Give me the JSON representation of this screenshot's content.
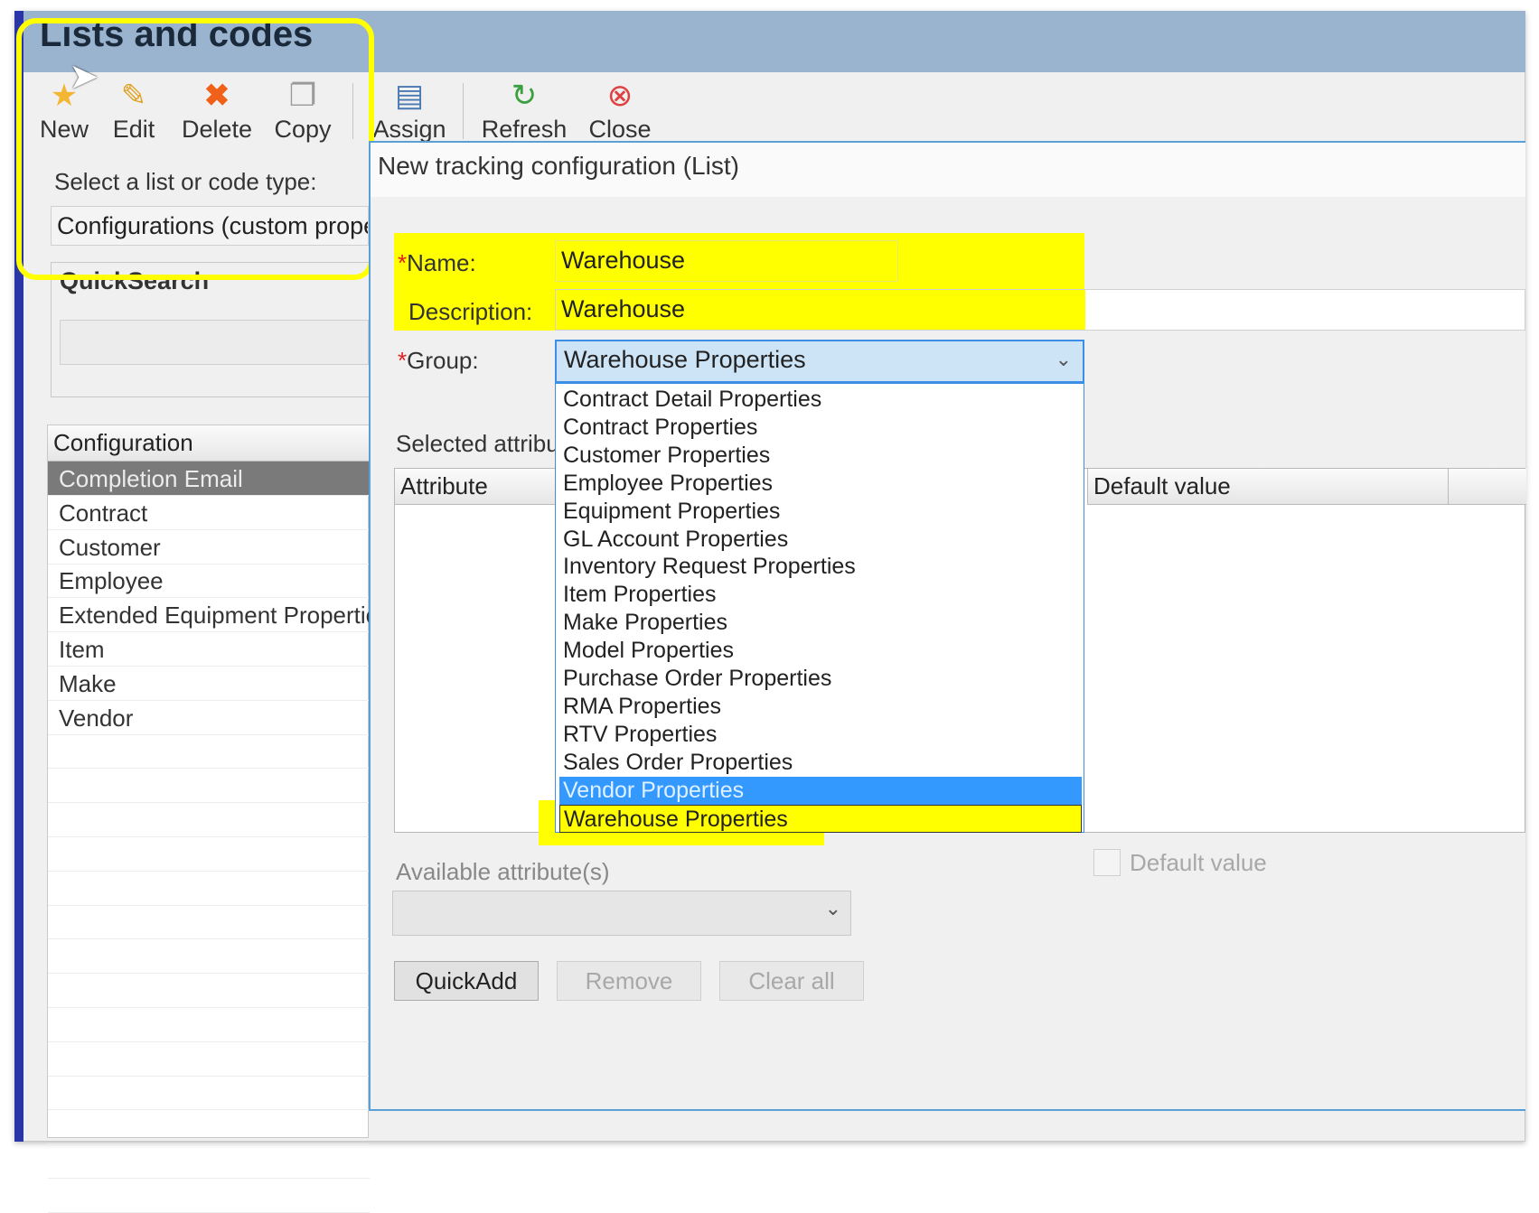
{
  "app": {
    "title": "Lists and codes"
  },
  "toolbar": {
    "new": "New",
    "edit": "Edit",
    "delete": "Delete",
    "copy": "Copy",
    "assign": "Assign",
    "refresh": "Refresh",
    "close": "Close"
  },
  "left": {
    "select_label": "Select a list or code type:",
    "select_value": "Configurations (custom proper",
    "quicksearch_label": "QuickSearch",
    "column_header": "Configuration",
    "rows": [
      "Completion Email",
      "Contract",
      "Customer",
      "Employee",
      "Extended Equipment Propertie",
      "Item",
      "Make",
      "Vendor"
    ],
    "selected_index": 0
  },
  "form": {
    "title": "New tracking configuration (List)",
    "name_label": "Name:",
    "name_value": "Warehouse",
    "description_label": "Description:",
    "description_value": "Warehouse",
    "group_label": "Group:",
    "group_value": "Warehouse Properties",
    "selected_attributes_label": "Selected attribu",
    "attribute_col": "Attribute",
    "default_value_col": "Default value",
    "available_attributes_label": "Available attribute(s)",
    "default_value_checkbox": "Default value",
    "quickadd": "QuickAdd",
    "remove": "Remove",
    "clear_all": "Clear all"
  },
  "dropdown": {
    "options": [
      "Contract Detail Properties",
      "Contract Properties",
      "Customer Properties",
      "Employee Properties",
      "Equipment Properties",
      "GL Account Properties",
      "Inventory Request Properties",
      "Item Properties",
      "Make Properties",
      "Model Properties",
      "Purchase Order Properties",
      "RMA Properties",
      "RTV Properties",
      "Sales Order Properties",
      "Vendor Properties",
      "Warehouse Properties"
    ],
    "highlighted_index": 14
  },
  "colors": {
    "highlight": "#ffff00",
    "selection": "#3399ff",
    "panel_border": "#5aa0d8",
    "title_bar": "#9ab4d0"
  }
}
